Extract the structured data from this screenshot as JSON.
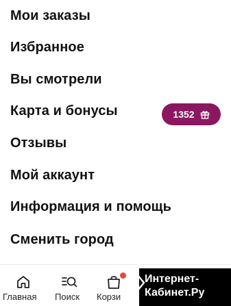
{
  "menu": {
    "items": [
      {
        "label": "Мои заказы"
      },
      {
        "label": "Избранное"
      },
      {
        "label": "Вы смотрели"
      },
      {
        "label": "Карта и бонусы"
      },
      {
        "label": "Отзывы"
      },
      {
        "label": "Мой аккаунт"
      },
      {
        "label": "Информация и помощь"
      },
      {
        "label": "Сменить город"
      }
    ],
    "bonus_badge": {
      "value": "1352",
      "icon": "gift-icon",
      "color": "#8c1761"
    }
  },
  "tabbar": {
    "tabs": [
      {
        "label": "Главная",
        "icon": "home-icon"
      },
      {
        "label": "Поиск",
        "icon": "search-icon"
      },
      {
        "label": "Корзи",
        "icon": "cart-icon"
      }
    ],
    "cart_indicator_color": "#e8473b"
  },
  "watermark": {
    "line1": "Интернет-",
    "line2": "Кабинет.Ру"
  }
}
